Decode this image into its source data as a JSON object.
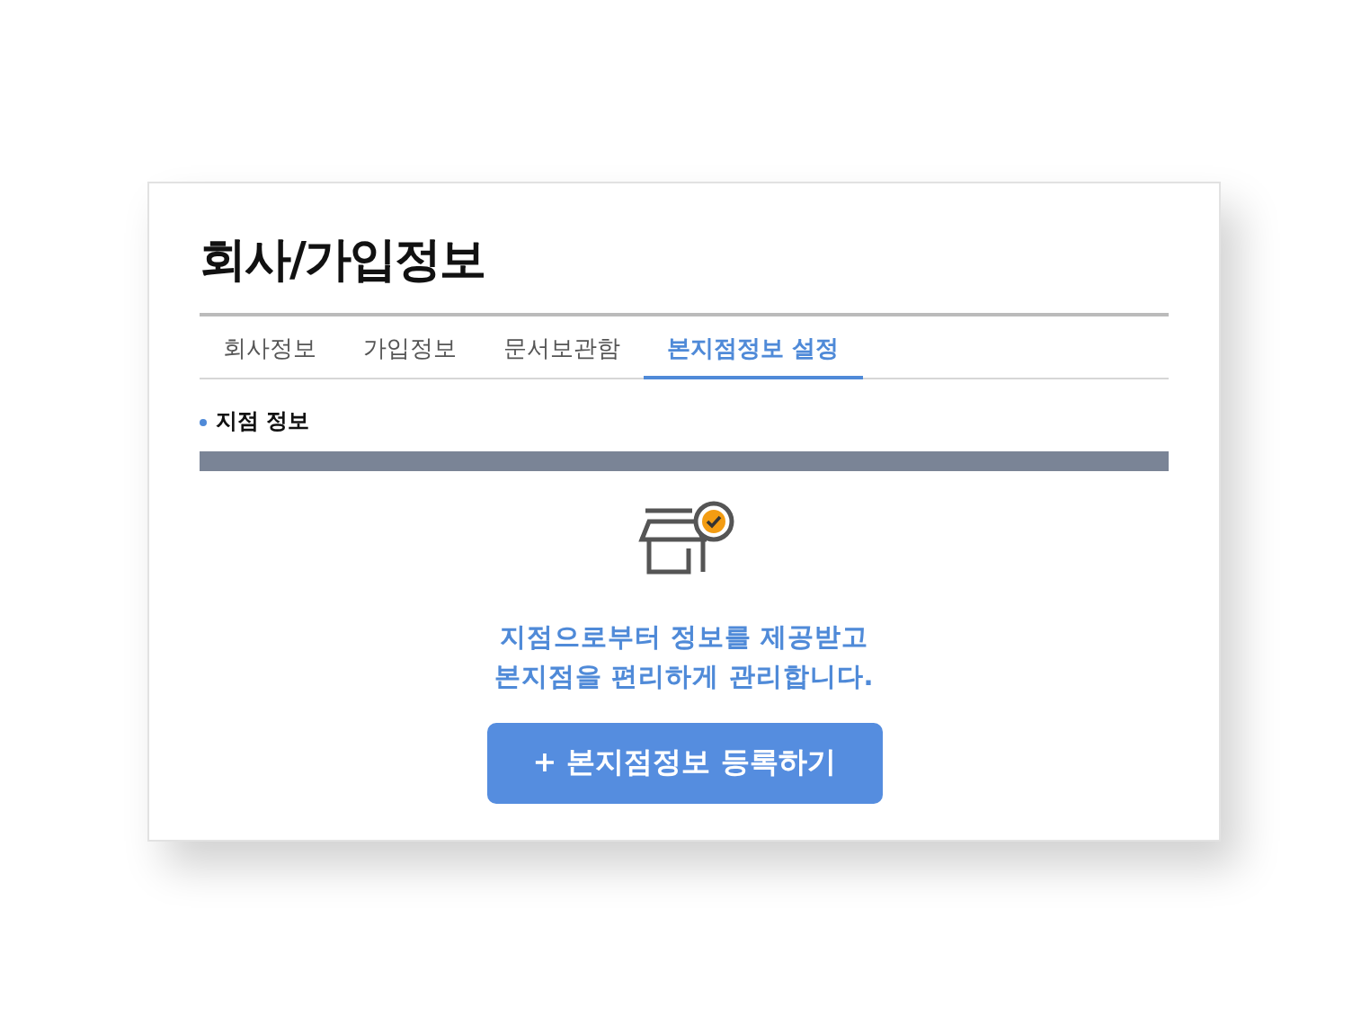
{
  "title": "회사/가입정보",
  "tabs": [
    {
      "label": "회사정보",
      "selected": false
    },
    {
      "label": "가입정보",
      "selected": false
    },
    {
      "label": "문서보관함",
      "selected": false
    },
    {
      "label": "본지점정보 설정",
      "selected": true
    }
  ],
  "section": {
    "heading": "지점 정보"
  },
  "empty_state": {
    "lines": [
      "지점으로부터 정보를 제공받고",
      "본지점을 편리하게 관리합니다."
    ],
    "button": "+ 본지점정보 등록하기"
  }
}
